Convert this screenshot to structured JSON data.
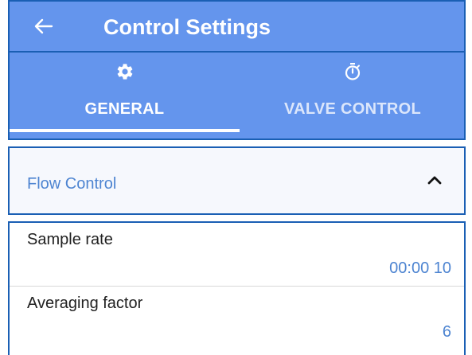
{
  "app_bar": {
    "title": "Control Settings",
    "back_icon": "arrow-left-icon"
  },
  "tabs": [
    {
      "label": "GENERAL",
      "icon": "gear-icon",
      "selected": true
    },
    {
      "label": "VALVE CONTROL",
      "icon": "stopwatch-icon",
      "selected": false
    }
  ],
  "flow_panel": {
    "title": "Flow Control",
    "expanded": true,
    "chevron_icon": "chevron-up-icon"
  },
  "settings": [
    {
      "label": "Sample rate",
      "value": "00:00 10"
    },
    {
      "label": "Averaging factor",
      "value": "6"
    }
  ],
  "colors": {
    "primary": "#6495ed",
    "border": "#1a5fb4",
    "accent_text": "#4d84d1",
    "tab_inactive_text": "#dbe6fb"
  }
}
